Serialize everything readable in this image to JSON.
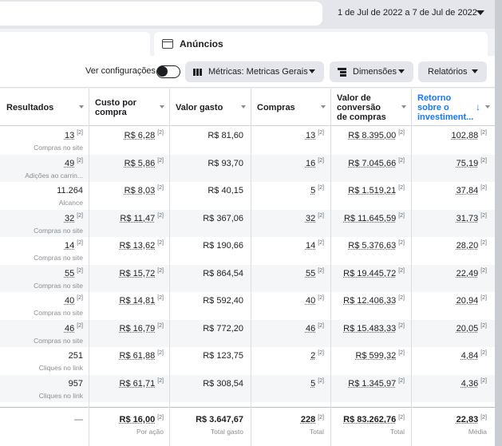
{
  "header": {
    "date_range": "1 de Jul de 2022 a 7 de Jul de 2022"
  },
  "tabs": {
    "anuncios_label": "Anúncios"
  },
  "toolbar": {
    "ver_config_label": "Ver configurações",
    "metrics_label": "Métricas: Metricas Gerais",
    "dimensions_label": "Dimensões",
    "reports_label": "Relatórios"
  },
  "columns": [
    {
      "label": "Resultados",
      "sorted": false
    },
    {
      "label": "Custo por compra",
      "sorted": false
    },
    {
      "label": "Valor gasto",
      "sorted": false
    },
    {
      "label": "Compras",
      "sorted": false
    },
    {
      "label": "Valor de conversão de compras",
      "sorted": false
    },
    {
      "label": "Retorno sobre o investiment...",
      "sorted": true
    }
  ],
  "rows": [
    {
      "resultados": "13",
      "resultados_sub": "Compras no site",
      "custo": "R$ 6,28",
      "gasto": "R$ 81,60",
      "compras": "13",
      "valor_conv": "R$ 8.395,00",
      "retorno": "102,88"
    },
    {
      "resultados": "49",
      "resultados_sub": "Adições ao carrin...",
      "custo": "R$ 5,86",
      "gasto": "R$ 93,70",
      "compras": "16",
      "valor_conv": "R$ 7.045,66",
      "retorno": "75,19"
    },
    {
      "resultados": "11.264",
      "resultados_sub": "Alcance",
      "custo": "R$ 8,03",
      "gasto": "R$ 40,15",
      "compras": "5",
      "valor_conv": "R$ 1.519,21",
      "retorno": "37,84"
    },
    {
      "resultados": "32",
      "resultados_sub": "Compras no site",
      "custo": "R$ 11,47",
      "gasto": "R$ 367,06",
      "compras": "32",
      "valor_conv": "R$ 11.645,59",
      "retorno": "31,73"
    },
    {
      "resultados": "14",
      "resultados_sub": "Compras no site",
      "custo": "R$ 13,62",
      "gasto": "R$ 190,66",
      "compras": "14",
      "valor_conv": "R$ 5.376,63",
      "retorno": "28,20"
    },
    {
      "resultados": "55",
      "resultados_sub": "Compras no site",
      "custo": "R$ 15,72",
      "gasto": "R$ 864,54",
      "compras": "55",
      "valor_conv": "R$ 19.445,72",
      "retorno": "22,49"
    },
    {
      "resultados": "40",
      "resultados_sub": "Compras no site",
      "custo": "R$ 14,81",
      "gasto": "R$ 592,40",
      "compras": "40",
      "valor_conv": "R$ 12.406,33",
      "retorno": "20,94"
    },
    {
      "resultados": "46",
      "resultados_sub": "Compras no site",
      "custo": "R$ 16,79",
      "gasto": "R$ 772,20",
      "compras": "46",
      "valor_conv": "R$ 15.483,33",
      "retorno": "20,05"
    },
    {
      "resultados": "251",
      "resultados_sub": "Cliques no link",
      "custo": "R$ 61,88",
      "gasto": "R$ 123,75",
      "compras": "2",
      "valor_conv": "R$ 599,32",
      "retorno": "4,84"
    },
    {
      "resultados": "957",
      "resultados_sub": "Cliques no link",
      "custo": "R$ 61,71",
      "gasto": "R$ 308,54",
      "compras": "5",
      "valor_conv": "R$ 1.345,97",
      "retorno": "4,36"
    }
  ],
  "totals": {
    "resultados": "—",
    "custo": "R$ 16,00",
    "custo_sub": "Por ação",
    "gasto": "R$ 3.647,67",
    "gasto_sub": "Total gasto",
    "compras": "228",
    "compras_sub": "Total",
    "valor_conv": "R$ 83.262,76",
    "valor_conv_sub": "Total",
    "retorno": "22,83",
    "retorno_sub": "Média"
  },
  "info_marker": "[2]",
  "colors": {
    "accent": "#1877f2",
    "row_alt": "#f5f6f7"
  }
}
